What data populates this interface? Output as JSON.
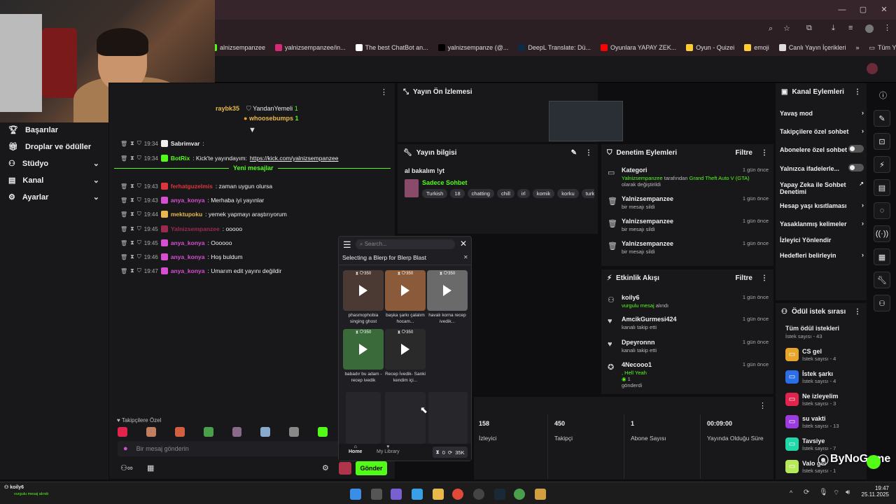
{
  "browser": {
    "bookmarks": [
      {
        "label": "alnizsempanzee",
        "color": "#53fc18"
      },
      {
        "label": "yalnizsempanzee/in...",
        "color": "#d62976"
      },
      {
        "label": "The best ChatBot an...",
        "color": "#ffffff"
      },
      {
        "label": "yalnizsempanze (@...",
        "color": "#000000"
      },
      {
        "label": "DeepL Translate: Dü...",
        "color": "#0f2b46"
      },
      {
        "label": "Oyunlara YAPAY ZEK...",
        "color": "#ff0000"
      },
      {
        "label": "Oyun - Quizei",
        "color": "#ffcc33"
      },
      {
        "label": "emoji",
        "color": "#ffcc33"
      },
      {
        "label": "Canlı Yayın İçerikleri",
        "color": "#dddddd"
      }
    ],
    "all_bookmarks": "Tüm Yer İşaretleri",
    "more": "»"
  },
  "sidenav": {
    "items": [
      {
        "label": "Başarılar",
        "icon": "trophy-icon",
        "chev": ""
      },
      {
        "label": "Droplar ve ödüller",
        "icon": "gift-icon",
        "chev": ""
      },
      {
        "label": "Stüdyo",
        "icon": "studio-icon",
        "chev": "⌄"
      },
      {
        "label": "Kanal",
        "icon": "channel-icon",
        "chev": "⌄"
      },
      {
        "label": "Ayarlar",
        "icon": "gear-icon",
        "chev": "⌄"
      }
    ]
  },
  "chat": {
    "top_users": [
      {
        "name": "raybk35",
        "color": "#e8b84a"
      },
      {
        "name": "YandanYemeli",
        "color": "#efefef",
        "count": "1"
      },
      {
        "name": "whoosebumps",
        "color": "#e8b84a",
        "count": "1"
      }
    ],
    "messages": [
      {
        "time": "19:34",
        "user": "Sabrimvar",
        "ucolor": "#efefef",
        "text": ":",
        "link": ""
      },
      {
        "time": "19:34",
        "user": "BotRix",
        "ucolor": "#53fc18",
        "text": ": Kick'te yayındayım: ",
        "link": "https://kick.com/yalnizsempanzee"
      },
      {
        "time": "19:43",
        "user": "ferhatguzelmis",
        "ucolor": "#e0343b",
        "text": ": zaman uygun olursa",
        "link": ""
      },
      {
        "time": "19:43",
        "user": "anya_konya",
        "ucolor": "#d64fd0",
        "text": ": Merhaba iyi yayınlar",
        "link": ""
      },
      {
        "time": "19:44",
        "user": "mektupoku",
        "ucolor": "#e8b84a",
        "text": ": yemek yapmayı araştırıyorum",
        "link": ""
      },
      {
        "time": "19:45",
        "user": "Yalnizsempanzee",
        "ucolor": "#9b2b4e",
        "text": ": ooooo",
        "link": ""
      },
      {
        "time": "19:45",
        "user": "anya_konya",
        "ucolor": "#d64fd0",
        "text": ": Oooooo",
        "link": ""
      },
      {
        "time": "19:46",
        "user": "anya_konya",
        "ucolor": "#d64fd0",
        "text": ": Hoş buldum",
        "link": ""
      },
      {
        "time": "19:47",
        "user": "anya_konya",
        "ucolor": "#d64fd0",
        "text": ": Umarım edit yayını değildir",
        "link": ""
      }
    ],
    "new_messages": "Yeni mesajlar",
    "followers_only": "Takipçilere Özel",
    "placeholder": "Bir mesaj gönderin",
    "send": "Gönder"
  },
  "preview": {
    "title": "Yayın Ön İzlemesi"
  },
  "stream_info": {
    "title": "Yayın bilgisi",
    "stream_title": "al bakalım !yt",
    "category": "Sadece Sohbet",
    "tags": [
      "Turkish",
      "18",
      "chatting",
      "chill",
      "irl",
      "komik",
      "korku",
      "turkis"
    ]
  },
  "moderation": {
    "title": "Denetim Eylemleri",
    "filter": "Filtre",
    "items": [
      {
        "title": "Kategori",
        "sub1": "Yalnizsempanzee",
        "sub2": " tarafından ",
        "sub3": "Grand Theft Auto V (GTA)",
        "sub4": "olarak değiştirildi",
        "when": "1 gün önce"
      },
      {
        "title": "Yalnizsempanzee",
        "sub": "bir mesajı sildi",
        "when": "1 gün önce"
      },
      {
        "title": "Yalnizsempanzee",
        "sub": "bir mesajı sildi",
        "when": "1 gün önce"
      },
      {
        "title": "Yalnizsempanzee",
        "sub": "bir mesajı sildi",
        "when": "1 gün önce"
      }
    ]
  },
  "activity": {
    "title": "Etkinlik Akışı",
    "filter": "Filtre",
    "items": [
      {
        "title": "koily6",
        "sub": "vurgulu mesaj",
        "sub2": " alındı",
        "when": "1 gün önce"
      },
      {
        "title": "AmcikGurmesi424",
        "sub": "kanalı takip etti",
        "when": "1 gün önce"
      },
      {
        "title": "Dpeyronnn",
        "sub": "kanalı takip etti",
        "when": "1 gün önce"
      },
      {
        "title": "4Necooo1",
        "sub": ", Hell Yeah",
        "sub2": "1",
        "sub3": "gönderdi",
        "when": "1 gün önce"
      }
    ]
  },
  "channel_actions": {
    "title": "Kanal Eylemleri",
    "items": [
      {
        "label": "Yavaş mod",
        "ctrl": "arrow"
      },
      {
        "label": "Takipçilere özel sohbet",
        "ctrl": "arrow"
      },
      {
        "label": "Abonelere özel sohbet",
        "ctrl": "toggle"
      },
      {
        "label": "Yalnızca ifadelerle...",
        "ctrl": "toggle"
      },
      {
        "label": "Yapay Zeka ile Sohbet Denetimi",
        "ctrl": "ext"
      },
      {
        "label": "Hesap yaşı kısıtlaması",
        "ctrl": "arrow"
      },
      {
        "label": "Yasaklanmış kelimeler",
        "ctrl": "arrow"
      },
      {
        "label": "İzleyici Yönlendir",
        "ctrl": ""
      },
      {
        "label": "Hedefleri belirleyin",
        "ctrl": "arrow"
      }
    ]
  },
  "rewards": {
    "title": "Ödül istek sırası",
    "all": "Tüm ödül istekleri",
    "all_count": "İstek sayısı - 43",
    "items": [
      {
        "name": "CS gel",
        "count": "İstek sayısı - 4",
        "color": "#e8a52a"
      },
      {
        "name": "İstek şarkı",
        "count": "İstek sayısı - 4",
        "color": "#2a6fe8"
      },
      {
        "name": "Ne izleyelim",
        "count": "İstek sayısı - 3",
        "color": "#e0244e"
      },
      {
        "name": "su vakti",
        "count": "İstek sayısı - 13",
        "color": "#9b3be0"
      },
      {
        "name": "Tavsiye",
        "count": "İstek sayısı - 7",
        "color": "#1fd8a8"
      },
      {
        "name": "Valo gel",
        "count": "İstek sayısı - 1",
        "color": "#b7e85a"
      }
    ]
  },
  "stats": [
    {
      "value": "158",
      "label": "İzleyici"
    },
    {
      "value": "450",
      "label": "Takipçi"
    },
    {
      "value": "1",
      "label": "Abone Sayısı"
    },
    {
      "value": "00:09:00",
      "label": "Yayında Olduğu Süre"
    }
  ],
  "blerp": {
    "search_placeholder": "Search...",
    "heading": "Selecting a Blerp for Blerp Blast",
    "items": [
      {
        "cost": "350",
        "caption": "phasmophobia singing ghost",
        "color": "#4a3a33"
      },
      {
        "cost": "350",
        "caption": "başka şarkı çalalım hocam...",
        "color": "#8a5a3a"
      },
      {
        "cost": "350",
        "caption": "havalı korna recep ivedik...",
        "color": "#6a6a6a"
      },
      {
        "cost": "350",
        "caption": "babadır bu adam - recep ivedik",
        "color": "#3a6a3a"
      },
      {
        "cost": "350",
        "caption": "Recep İvedik- Sanki kendim içi...",
        "color": "#2a2a2a"
      }
    ],
    "home": "Home",
    "library": "My Library",
    "balance": "0",
    "points": "35K"
  },
  "notification": {
    "user": "koily6",
    "text": "vurgulu mesaj alındı"
  },
  "watermark": "ByNoGame",
  "taskbar": {
    "time": "19:47",
    "date": "25.11.2025"
  }
}
